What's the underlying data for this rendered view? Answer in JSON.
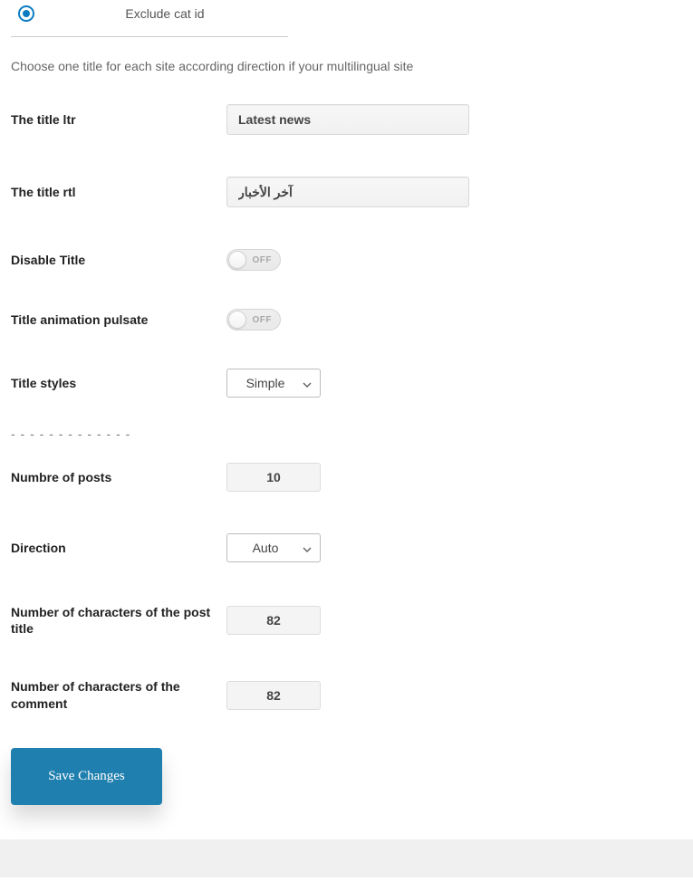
{
  "radio": {
    "label": "Exclude cat id",
    "checked": true
  },
  "helper_text": "Choose one title for each site according direction if your multilingual site",
  "fields": {
    "title_ltr": {
      "label": "The title ltr",
      "value": "Latest news"
    },
    "title_rtl": {
      "label": "The title rtl",
      "value": "آخر الأخبار"
    },
    "disable_title": {
      "label": "Disable Title",
      "state_text": "OFF"
    },
    "title_anim": {
      "label": "Title animation pulsate",
      "state_text": "OFF"
    },
    "title_styles": {
      "label": "Title styles",
      "value": "Simple"
    },
    "num_posts": {
      "label": "Numbre of posts",
      "value": "10"
    },
    "direction": {
      "label": "Direction",
      "value": "Auto"
    },
    "chars_title": {
      "label": "Number of characters of the post title",
      "value": "82"
    },
    "chars_comment": {
      "label": "Number of characters of the comment",
      "value": "82"
    }
  },
  "separator": "- - - - - - - - - - - - -",
  "save_label": "Save Changes"
}
